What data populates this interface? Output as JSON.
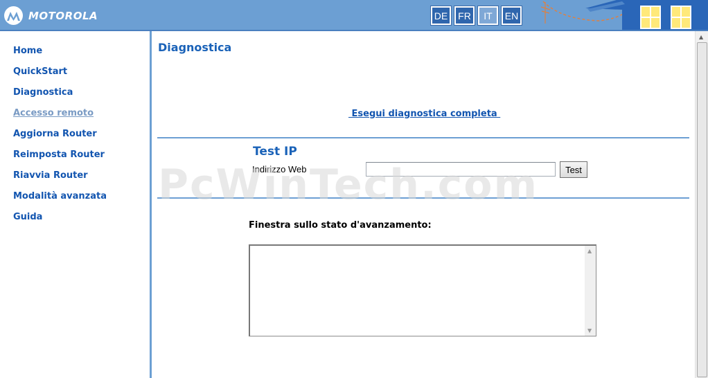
{
  "header": {
    "brand": "MOTOROLA",
    "languages": [
      {
        "code": "DE"
      },
      {
        "code": "FR"
      },
      {
        "code": "IT",
        "active": true
      },
      {
        "code": "EN"
      }
    ]
  },
  "sidebar": {
    "items": [
      {
        "label": "Home"
      },
      {
        "label": "QuickStart"
      },
      {
        "label": "Diagnostica"
      },
      {
        "label": "Accesso remoto",
        "visited": true
      },
      {
        "label": "Aggiorna Router"
      },
      {
        "label": "Reimposta Router"
      },
      {
        "label": "Riavvia Router"
      },
      {
        "label": "Modalità avanzata"
      },
      {
        "label": "Guida"
      }
    ]
  },
  "main": {
    "title": "Diagnostica",
    "full_diag_link": " Esegui diagnostica completa ",
    "test_ip": {
      "title": "Test IP",
      "field_label": "Indirizzo Web",
      "input_value": "",
      "button_label": "Test"
    },
    "progress_label": "Finestra sullo stato d'avanzamento:"
  },
  "watermark": "PcWinTech.com",
  "colors": {
    "header_bg": "#6c9fd3",
    "link": "#1255b0",
    "title": "#1a62b8",
    "lang_btn": "#2f66ad"
  }
}
